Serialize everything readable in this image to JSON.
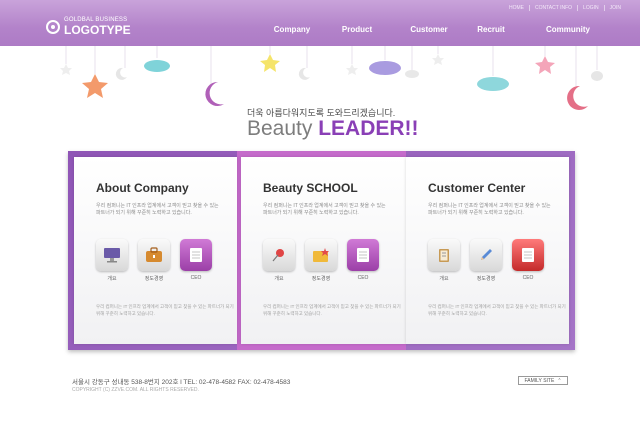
{
  "logo": {
    "sub": "GOLDBAL BUSINESS",
    "main": "LOGOTYPE"
  },
  "util_nav": [
    "HOME",
    "CONTACT INFO",
    "LOGIN",
    "JOIN"
  ],
  "gnb": [
    "Company",
    "Product",
    "Customer",
    "Recruit",
    "Community"
  ],
  "hero": {
    "tagline": "더욱 아름다워지도록 도와드리겠습니다.",
    "headline_light": "Beauty ",
    "headline_bold": "LEADER!!"
  },
  "cards": [
    {
      "title": "About Company",
      "desc": "우리 컴퍼니는 IT 인프라 업계에서 고객이 믿고 찾을 수 있는 파트너가 되기 위해 꾸준히 노력하고 있습니다.",
      "icons": [
        {
          "label": "개요",
          "icon": "monitor-icon"
        },
        {
          "label": "정도경영",
          "icon": "briefcase-icon"
        },
        {
          "label": "CEO",
          "icon": "notebook-icon"
        }
      ],
      "note": "우리 컴퍼니는 IT 인프라 업계에서 고객이 믿고 찾을 수 있는 파트너가 되기 위해 꾸준히 노력하고 있습니다."
    },
    {
      "title": "Beauty SCHOOL",
      "desc": "우리 컴퍼니는 IT 인프라 업계에서 고객이 믿고 찾을 수 있는 파트너가 되기 위해 꾸준히 노력하고 있습니다.",
      "icons": [
        {
          "label": "개요",
          "icon": "pushpin-icon"
        },
        {
          "label": "정도경영",
          "icon": "folder-star-icon"
        },
        {
          "label": "CEO",
          "icon": "notebook-icon"
        }
      ],
      "note": "우리 컴퍼니는 IT 인프라 업계에서 고객이 믿고 찾을 수 있는 파트너가 되기 위해 꾸준히 노력하고 있습니다."
    },
    {
      "title": "Customer Center",
      "desc": "우리 컴퍼니는 IT 인프라 업계에서 고객이 믿고 찾을 수 있는 파트너가 되기 위해 꾸준히 노력하고 있습니다.",
      "icons": [
        {
          "label": "개요",
          "icon": "notepad-icon"
        },
        {
          "label": "정도경영",
          "icon": "pencil-icon"
        },
        {
          "label": "CEO",
          "icon": "book-icon"
        }
      ],
      "note": "우리 컴퍼니는 IT 인프라 업계에서 고객이 믿고 찾을 수 있는 파트너가 되기 위해 꾸준히 노력하고 있습니다."
    }
  ],
  "footer": {
    "address": "서울시 강동구 성내동 538-8번지 202호 l  TEL: 02-478-4582  FAX: 02-478-4583",
    "copyright": "COPYRIGHT (C) ZZVE.COM. ALL RIGHTS RESERVED.",
    "family_site": "FAMILY SITE",
    "family_caret": "⌃"
  },
  "colors": {
    "accent": "#8a3fb6",
    "header": "#b383ca",
    "panel": "#9b63bf"
  }
}
